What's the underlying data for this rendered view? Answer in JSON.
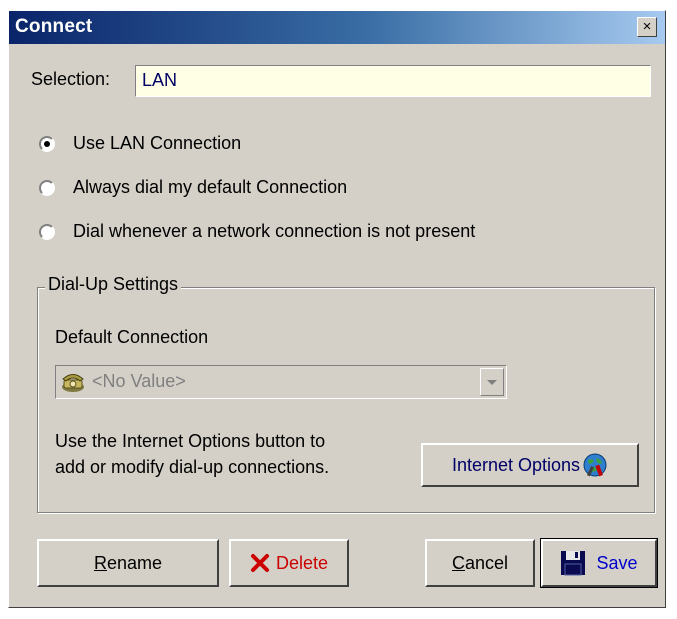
{
  "window": {
    "title": "Connect",
    "close_glyph": "×"
  },
  "selection": {
    "label": "Selection:",
    "value": "LAN"
  },
  "connection_options": [
    {
      "label": "Use LAN Connection",
      "selected": true
    },
    {
      "label": "Always dial my default Connection",
      "selected": false
    },
    {
      "label": "Dial whenever a network connection is not present",
      "selected": false
    }
  ],
  "dialup": {
    "legend": "Dial-Up Settings",
    "default_label": "Default Connection",
    "default_value": "<No Value>",
    "default_icon": "phone-icon",
    "help_line1": "Use the Internet Options button to",
    "help_line2": "add or modify dial-up connections.",
    "internet_options_label": "Internet Options",
    "internet_options_icon": "globe-tools-icon"
  },
  "buttons": {
    "rename_first": "R",
    "rename_rest": "ename",
    "delete": "Delete",
    "cancel_first": "C",
    "cancel_rest": "ancel",
    "save": "Save"
  },
  "colors": {
    "title_bar": "#0a246a",
    "face": "#d4d0c8",
    "selection_bg": "#ffffe6",
    "delete_red": "#cc0000",
    "save_blue": "#0000cc"
  }
}
